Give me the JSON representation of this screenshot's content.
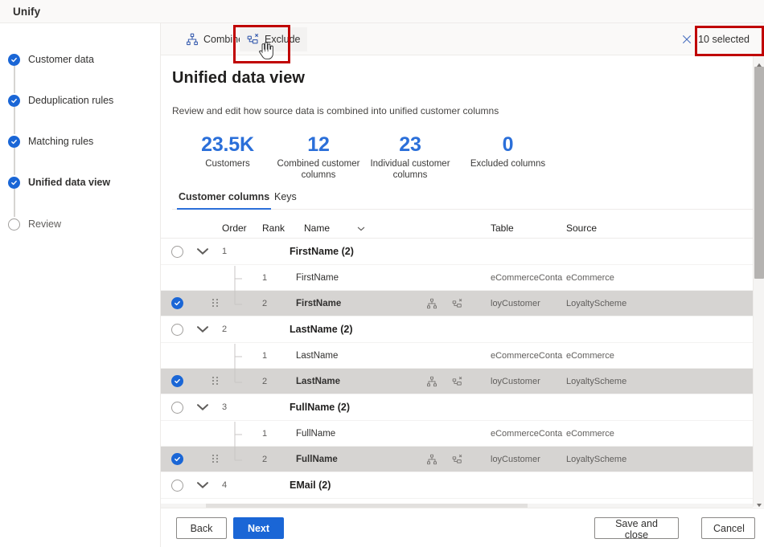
{
  "window": {
    "title": "Unify"
  },
  "colors": {
    "accent": "#1a66d6",
    "stat_number": "#2b6fd9",
    "annotation": "#c00000",
    "selected_row": "#d6d4d2"
  },
  "sidebar": {
    "steps": [
      {
        "label": "Customer data",
        "state": "done"
      },
      {
        "label": "Deduplication rules",
        "state": "done"
      },
      {
        "label": "Matching rules",
        "state": "done"
      },
      {
        "label": "Unified data view",
        "state": "active"
      },
      {
        "label": "Review",
        "state": "pending"
      }
    ]
  },
  "commandbar": {
    "combine_label": "Combine",
    "combine_icon": "combine-hierarchy-icon",
    "exclude_label": "Exclude",
    "exclude_icon": "exclude-column-icon",
    "selection_label": "10 selected",
    "selection_count": 10,
    "clear_icon": "close-x-icon"
  },
  "main": {
    "title": "Unified data view",
    "subtitle": "Review and edit how source data is combined into unified customer columns",
    "stats": [
      {
        "value": "23.5K",
        "caption": "Customers"
      },
      {
        "value": "12",
        "caption": "Combined customer columns"
      },
      {
        "value": "23",
        "caption": "Individual customer columns"
      },
      {
        "value": "0",
        "caption": "Excluded columns"
      }
    ],
    "tabs": [
      {
        "label": "Customer columns",
        "selected": true
      },
      {
        "label": "Keys",
        "selected": false
      }
    ],
    "table": {
      "headers": {
        "expand": "",
        "order": "Order",
        "rank": "Rank",
        "name": "Name",
        "table": "Table",
        "source": "Source"
      },
      "rows": [
        {
          "kind": "group",
          "checked": false,
          "order": "1",
          "name": "FirstName (2)"
        },
        {
          "kind": "child",
          "checked": false,
          "rank": "1",
          "name": "FirstName",
          "table": "eCommerceConta…",
          "source": "eCommerce",
          "icons": []
        },
        {
          "kind": "child",
          "checked": true,
          "rank": "2",
          "name": "FirstName",
          "table": "loyCustomer",
          "source": "LoyaltyScheme",
          "icons": [
            "combine-hierarchy-icon",
            "exclude-column-icon"
          ]
        },
        {
          "kind": "group",
          "checked": false,
          "order": "2",
          "name": "LastName (2)"
        },
        {
          "kind": "child",
          "checked": false,
          "rank": "1",
          "name": "LastName",
          "table": "eCommerceConta…",
          "source": "eCommerce",
          "icons": []
        },
        {
          "kind": "child",
          "checked": true,
          "rank": "2",
          "name": "LastName",
          "table": "loyCustomer",
          "source": "LoyaltyScheme",
          "icons": [
            "combine-hierarchy-icon",
            "exclude-column-icon"
          ]
        },
        {
          "kind": "group",
          "checked": false,
          "order": "3",
          "name": "FullName (2)"
        },
        {
          "kind": "child",
          "checked": false,
          "rank": "1",
          "name": "FullName",
          "table": "eCommerceConta…",
          "source": "eCommerce",
          "icons": []
        },
        {
          "kind": "child",
          "checked": true,
          "rank": "2",
          "name": "FullName",
          "table": "loyCustomer",
          "source": "LoyaltyScheme",
          "icons": [
            "combine-hierarchy-icon",
            "exclude-column-icon"
          ]
        },
        {
          "kind": "group",
          "checked": false,
          "order": "4",
          "name": "EMail (2)"
        }
      ]
    }
  },
  "footer": {
    "back_label": "Back",
    "next_label": "Next",
    "save_label": "Save and close",
    "cancel_label": "Cancel"
  }
}
